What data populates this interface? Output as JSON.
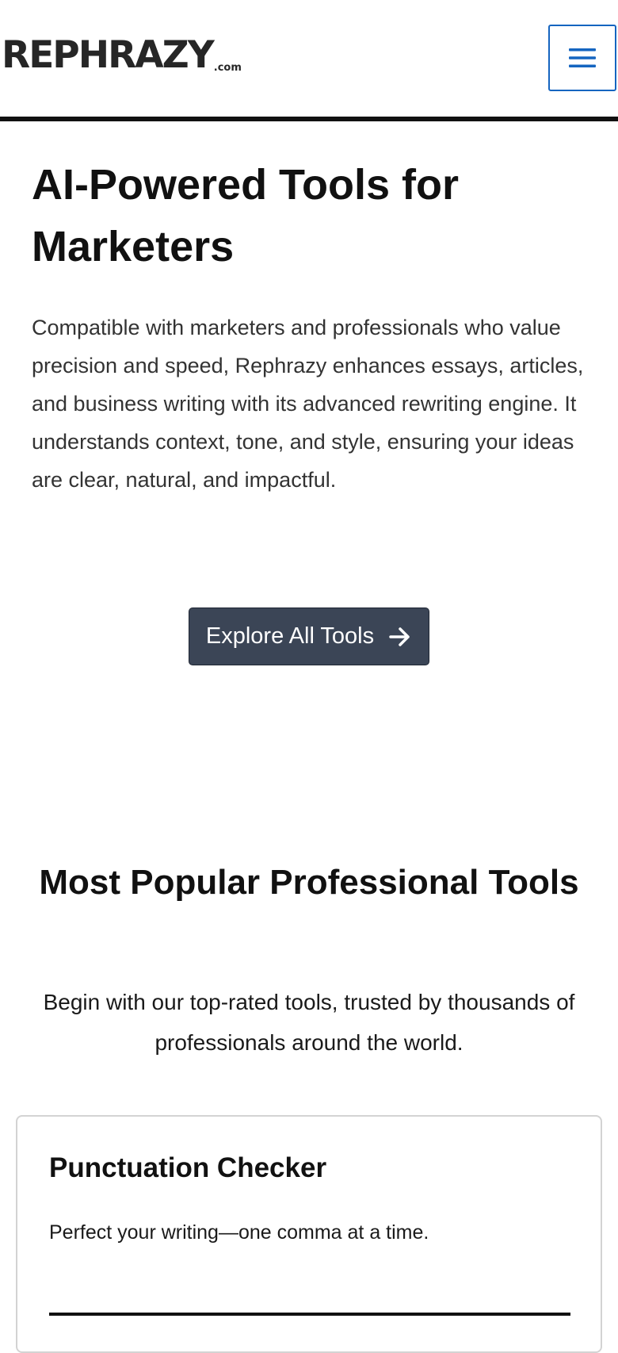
{
  "header": {
    "logo_main": "REPHRAZY",
    "logo_tld": ".com",
    "menu_icon": "hamburger-menu-icon",
    "menu_color": "#1565c0"
  },
  "hero": {
    "title": "AI-Powered Tools for Marketers",
    "description": "Compatible with marketers and professionals who value precision and speed, Rephrazy enhances essays, articles, and business writing with its advanced rewriting engine. It understands context, tone, and style, ensuring your ideas are clear, natural, and impactful.",
    "cta_label": "Explore All Tools",
    "cta_icon": "arrow-right-icon",
    "cta_color": "#3b4556"
  },
  "popular": {
    "title": "Most Popular Professional Tools",
    "subtitle": "Begin with our top-rated tools, trusted by thousands of professionals around the world."
  },
  "tools": [
    {
      "title": "Punctuation Checker",
      "description": "Perfect your writing—one comma at a time."
    }
  ]
}
